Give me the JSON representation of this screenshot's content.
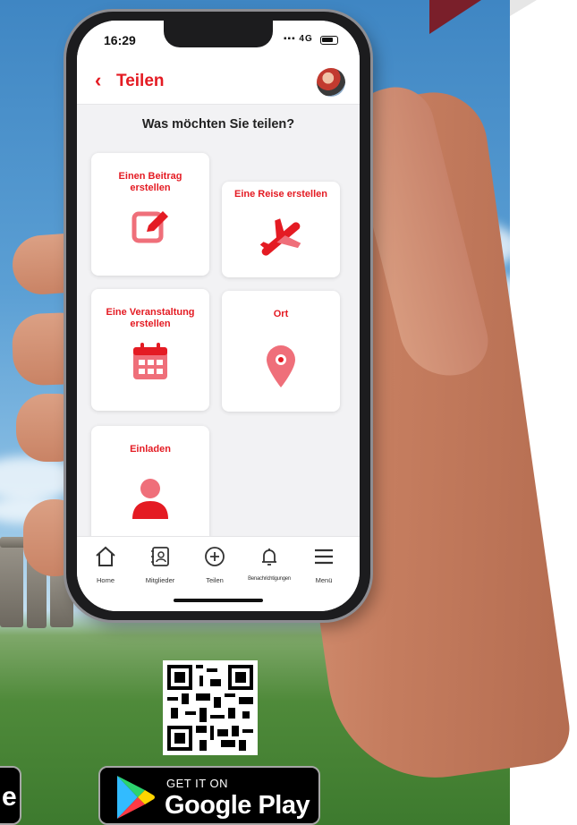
{
  "status_bar": {
    "time": "16:29",
    "network": "4G"
  },
  "header": {
    "back_icon": "chevron-left-icon",
    "title": "Teilen"
  },
  "question": "Was möchten Sie teilen?",
  "cards": [
    {
      "label": "Einen Beitrag erstellen",
      "icon": "edit-icon"
    },
    {
      "label": "Eine Reise erstellen",
      "icon": "airplane-icon"
    },
    {
      "label": "Eine Veranstaltung erstellen",
      "icon": "calendar-icon"
    },
    {
      "label": "Ort",
      "icon": "map-pin-icon"
    },
    {
      "label": "Einladen",
      "icon": "person-icon"
    }
  ],
  "tabs": [
    {
      "label": "Home",
      "icon": "home-icon"
    },
    {
      "label": "Mitglieder",
      "icon": "contacts-icon"
    },
    {
      "label": "Teilen",
      "icon": "plus-circle-icon"
    },
    {
      "label": "Benachrichtigungen",
      "icon": "bell-icon"
    },
    {
      "label": "Menü",
      "icon": "menu-icon"
    }
  ],
  "store_badges": {
    "google_play": {
      "small": "GET IT ON",
      "big": "Google Play"
    }
  },
  "colors": {
    "accent": "#e41b23",
    "icon_pink": "#ef6f7a"
  }
}
